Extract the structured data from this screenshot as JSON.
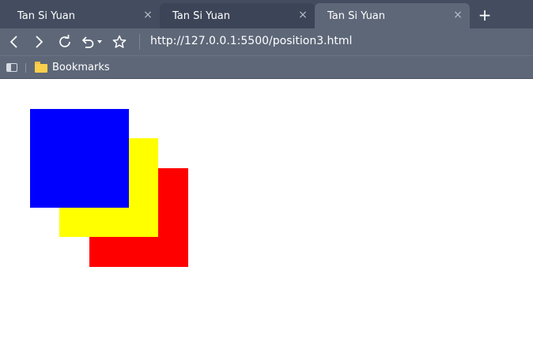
{
  "tabs": [
    {
      "title": "Tan Si Yuan",
      "close": "×"
    },
    {
      "title": "Tan Si Yuan",
      "close": "×"
    },
    {
      "title": "Tan Si Yuan",
      "close": "×"
    }
  ],
  "new_tab_label": "+",
  "address_bar": {
    "url": "http://127.0.0.1:5500/position3.html"
  },
  "bookmarks_bar": {
    "folder_label": "Bookmarks"
  },
  "icons": [
    "back-icon",
    "forward-icon",
    "reload-icon",
    "undo-icon",
    "dropdown-icon",
    "star-icon",
    "sidebar-icon",
    "folder-icon"
  ],
  "boxes": [
    {
      "name": "red-box",
      "color": "#ff0000"
    },
    {
      "name": "yellow-box",
      "color": "#ffff00"
    },
    {
      "name": "blue-box",
      "color": "#0000ff"
    }
  ]
}
